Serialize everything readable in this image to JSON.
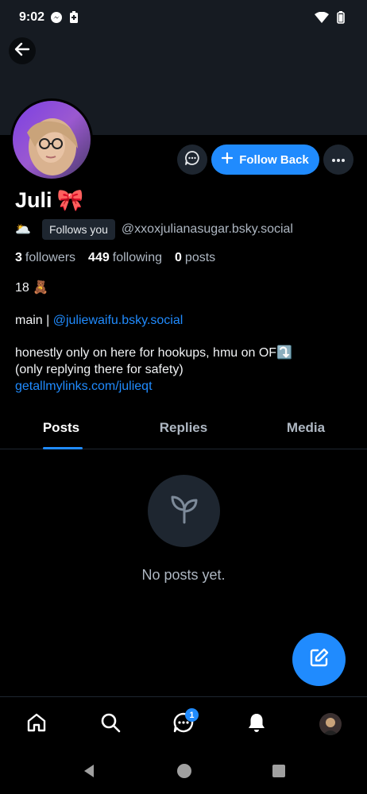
{
  "status_bar": {
    "time": "9:02"
  },
  "profile": {
    "display_name": "Juli",
    "name_emoji": "🎀",
    "handle_emoji": "🌥️",
    "follows_you": "Follows you",
    "handle": "@xxoxjulianasugar.bsky.social",
    "stats": {
      "followers_count": "3",
      "followers_label": "followers",
      "following_count": "449",
      "following_label": "following",
      "posts_count": "0",
      "posts_label": "posts"
    },
    "bio": {
      "line1": "18 🧸",
      "line2_prefix": "main | ",
      "line2_link": "@juliewaifu.bsky.social",
      "line3": "honestly only on here for hookups, hmu on OF⤵️",
      "line4": "(only replying there for safety)",
      "line5_link": "getallmylinks.com/julieqt"
    }
  },
  "actions": {
    "follow_label": "Follow Back"
  },
  "tabs": [
    {
      "label": "Posts"
    },
    {
      "label": "Replies"
    },
    {
      "label": "Media"
    }
  ],
  "empty_state": {
    "text": "No posts yet."
  },
  "bottom_nav": {
    "messages_badge": "1"
  },
  "colors": {
    "accent": "#208bfe",
    "background": "#000000",
    "surface": "#1e2630",
    "muted_text": "#aeb7c2"
  }
}
